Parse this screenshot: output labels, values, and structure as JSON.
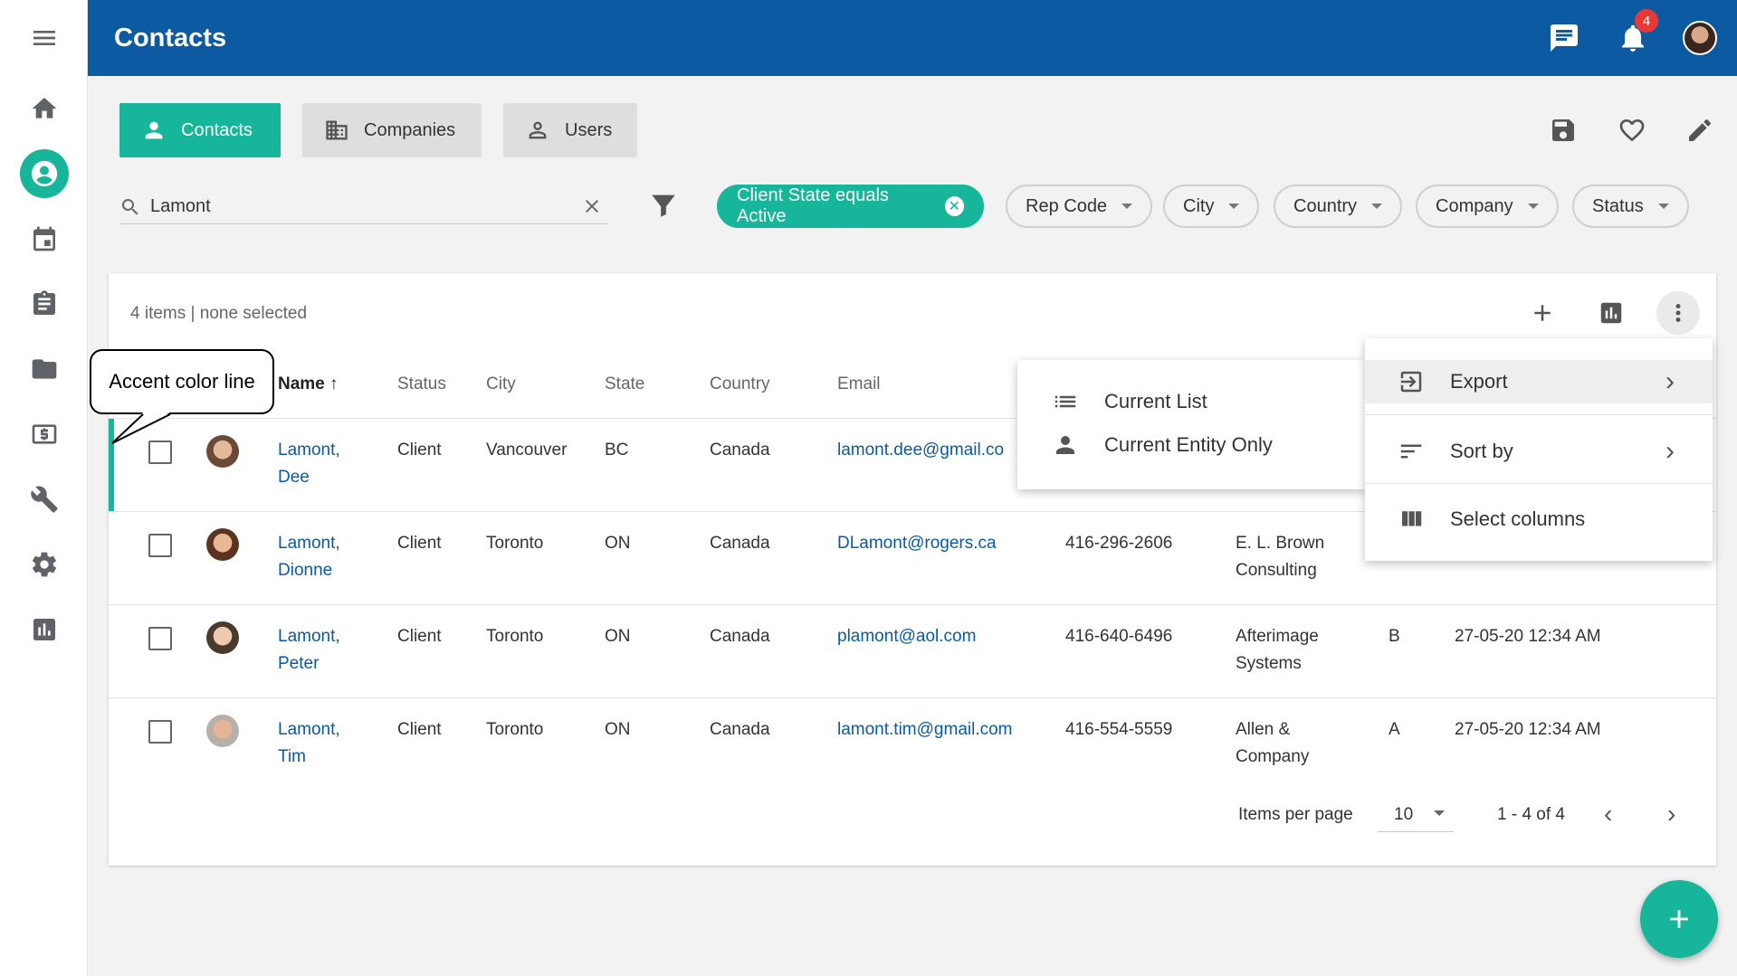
{
  "app": {
    "title": "Contacts",
    "notification_count": "4"
  },
  "rail": {
    "items": [
      "menu-icon",
      "home-icon",
      "contacts-icon",
      "calendar-icon",
      "clipboard-icon",
      "folder-icon",
      "billing-icon",
      "tools-icon",
      "settings-icon",
      "reports-icon"
    ]
  },
  "tabs": {
    "contacts": "Contacts",
    "companies": "Companies",
    "users": "Users"
  },
  "search": {
    "value": "Lamont",
    "placeholder": "Search"
  },
  "filters": {
    "active": "Client State equals Active",
    "chips": [
      "Rep Code",
      "City",
      "Country",
      "Company",
      "Status"
    ]
  },
  "list": {
    "count_text": "4 items",
    "selection_text": "none selected",
    "columns": [
      "Name",
      "Status",
      "City",
      "State",
      "Country",
      "Email"
    ],
    "rows": [
      {
        "name1": "Lamont,",
        "name2": "Dee",
        "status": "Client",
        "city": "Vancouver",
        "state": "BC",
        "country": "Canada",
        "email": "lamont.dee@gmail.co",
        "phone": "",
        "company1": "",
        "company2": "",
        "rep": "",
        "date": ""
      },
      {
        "name1": "Lamont,",
        "name2": "Dionne",
        "status": "Client",
        "city": "Toronto",
        "state": "ON",
        "country": "Canada",
        "email": "DLamont@rogers.ca",
        "phone": "416-296-2606",
        "company1": "E. L. Brown",
        "company2": "Consulting",
        "rep": "",
        "date": ""
      },
      {
        "name1": "Lamont,",
        "name2": "Peter",
        "status": "Client",
        "city": "Toronto",
        "state": "ON",
        "country": "Canada",
        "email": "plamont@aol.com",
        "phone": "416-640-6496",
        "company1": "Afterimage",
        "company2": "Systems",
        "rep": "B",
        "date": "27-05-20 12:34 AM"
      },
      {
        "name1": "Lamont,",
        "name2": "Tim",
        "status": "Client",
        "city": "Toronto",
        "state": "ON",
        "country": "Canada",
        "email": "lamont.tim@gmail.com",
        "phone": "416-554-5559",
        "company1": "Allen &",
        "company2": "Company",
        "rep": "A",
        "date": "27-05-20 12:34 AM"
      }
    ]
  },
  "pager": {
    "label": "Items per page",
    "per_page": "10",
    "range": "1 - 4 of 4"
  },
  "export_menu": {
    "current_list": "Current List",
    "current_entity": "Current Entity Only"
  },
  "more_menu": {
    "export": "Export",
    "sort_by": "Sort by",
    "select_columns": "Select columns"
  },
  "callout": {
    "text": "Accent color line"
  },
  "colors": {
    "brand": "#0b5aa2",
    "accent": "#17b59a",
    "badge": "#e53935"
  }
}
